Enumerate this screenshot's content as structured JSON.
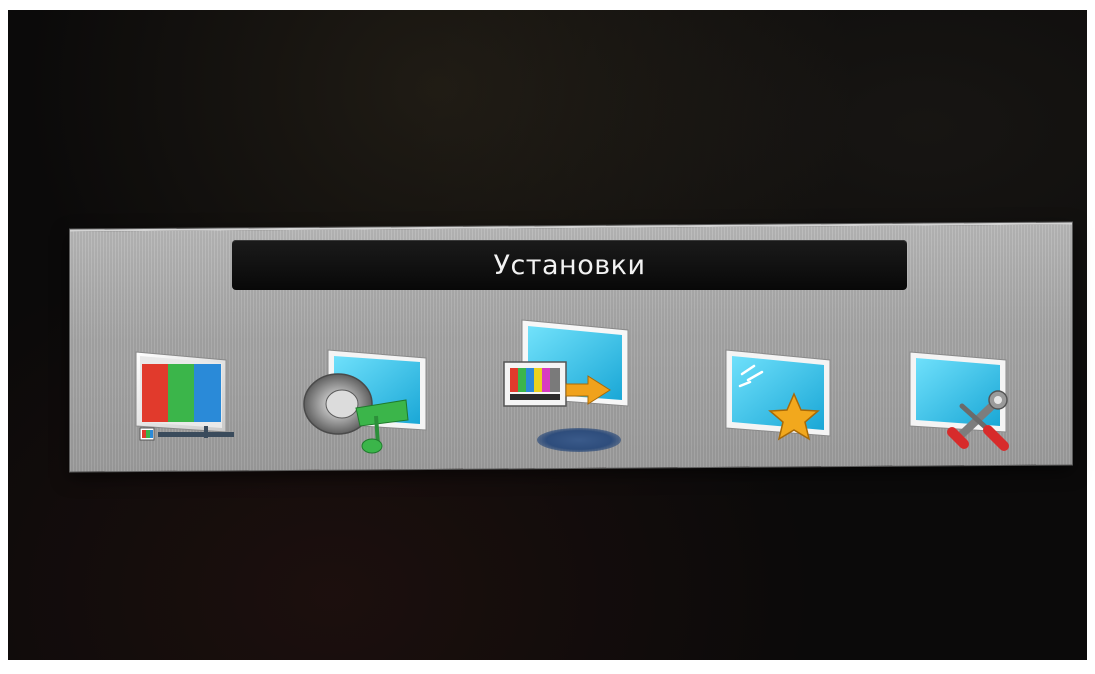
{
  "menu": {
    "title": "Установки",
    "selected_index": 2,
    "items": [
      {
        "id": "picture",
        "icon": "color-bars-monitor-icon"
      },
      {
        "id": "sound",
        "icon": "speaker-music-note-icon"
      },
      {
        "id": "channel",
        "icon": "monitor-test-pattern-arrow-icon"
      },
      {
        "id": "features",
        "icon": "monitor-star-icon"
      },
      {
        "id": "setup",
        "icon": "monitor-tools-icon"
      }
    ]
  },
  "colors": {
    "panel": "#a9a9a9",
    "title_bar": "#111111",
    "screen_blue": "#3ec7ea",
    "focus_glow": "#2e4d7c",
    "star": "#f2a81d",
    "note_green": "#3bb54a",
    "arrow_orange": "#f0a21c"
  }
}
